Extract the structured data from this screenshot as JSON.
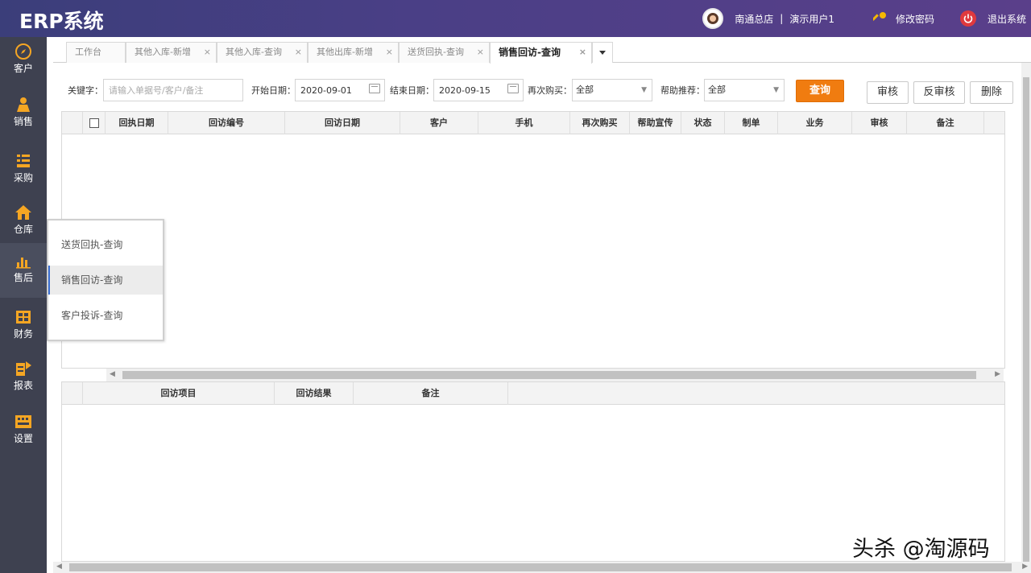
{
  "app": {
    "logo": "ERP系统"
  },
  "header": {
    "branch": "南通总店",
    "separator": "|",
    "user": "演示用户1",
    "change_password": "修改密码",
    "logout": "退出系统"
  },
  "sidebar": {
    "items": [
      {
        "label": "客户",
        "icon": "compass-icon"
      },
      {
        "label": "销售",
        "icon": "person-icon"
      },
      {
        "label": "采购",
        "icon": "list-icon"
      },
      {
        "label": "仓库",
        "icon": "house-icon"
      },
      {
        "label": "售后",
        "icon": "bar-chart-icon"
      },
      {
        "label": "财务",
        "icon": "grid-box-icon"
      },
      {
        "label": "报表",
        "icon": "report-icon"
      },
      {
        "label": "设置",
        "icon": "keyboard-icon"
      }
    ],
    "active_index": 4
  },
  "tabs": [
    {
      "label": "工作台",
      "closable": false
    },
    {
      "label": "其他入库-新增",
      "closable": true
    },
    {
      "label": "其他入库-查询",
      "closable": true
    },
    {
      "label": "其他出库-新增",
      "closable": true
    },
    {
      "label": "送货回执-查询",
      "closable": true
    },
    {
      "label": "销售回访-查询",
      "closable": true,
      "active": true
    }
  ],
  "tab_close_glyph": "×",
  "filter": {
    "keyword_label": "关键字：",
    "keyword_placeholder": "请输入单据号/客户/备注",
    "start_label": "开始日期：",
    "start_value": "2020-09-01",
    "end_label": "结束日期：",
    "end_value": "2020-09-15",
    "rebuy_label": "再次购买：",
    "rebuy_value": "全部",
    "recommend_label": "帮助推荐：",
    "recommend_value": "全部",
    "query_button": "查询",
    "audit_button": "审核",
    "unaudit_button": "反审核",
    "delete_button": "删除"
  },
  "main_table": {
    "columns": [
      "回执日期",
      "回访编号",
      "回访日期",
      "客户",
      "手机",
      "再次购买",
      "帮助宣传",
      "状态",
      "制单",
      "业务",
      "审核",
      "备注"
    ],
    "rows": []
  },
  "detail_table": {
    "columns": [
      "回访项目",
      "回访结果",
      "备注"
    ],
    "rows": []
  },
  "flyout": {
    "items": [
      "送货回执-查询",
      "销售回访-查询",
      "客户投诉-查询"
    ],
    "active_index": 1
  },
  "watermark": "头杀 @淘源码",
  "colors": {
    "header": "#4a3f86",
    "sidebar": "#3e4150",
    "accent": "#f07c10",
    "sidebar_icon": "#f5a623"
  }
}
